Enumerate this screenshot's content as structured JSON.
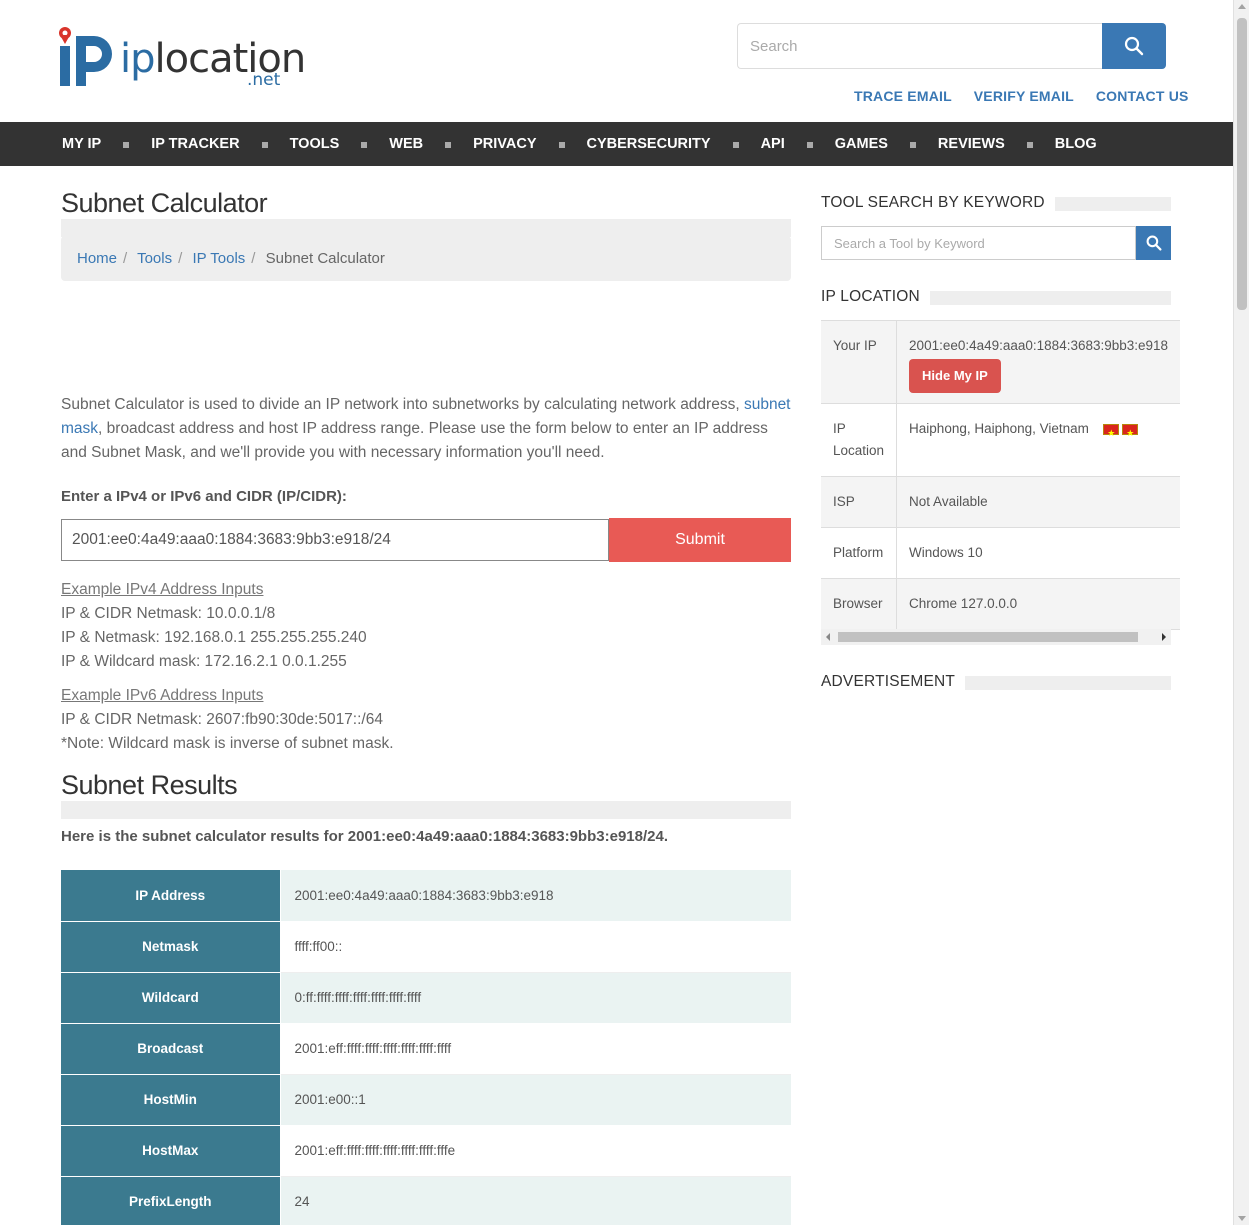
{
  "header": {
    "logo_ip": "ip",
    "logo_location": "location",
    "logo_net": ".net",
    "search_placeholder": "Search",
    "links": [
      "TRACE EMAIL",
      "VERIFY EMAIL",
      "CONTACT US"
    ]
  },
  "nav": [
    "MY IP",
    "IP TRACKER",
    "TOOLS",
    "WEB",
    "PRIVACY",
    "CYBERSECURITY",
    "API",
    "GAMES",
    "REVIEWS",
    "BLOG"
  ],
  "page": {
    "title": "Subnet Calculator",
    "breadcrumb": {
      "home": "Home",
      "tools": "Tools",
      "ip_tools": "IP Tools",
      "current": "Subnet Calculator"
    },
    "intro": {
      "before_link": "Subnet Calculator is used to divide an IP network into subnetworks by calculating network address, ",
      "link": "subnet mask",
      "after_link": ", broadcast address and host IP address range. Please use the form below to enter an IP address and Subnet Mask, and we'll provide you with necessary information you'll need."
    },
    "form": {
      "label": "Enter a IPv4 or IPv6 and CIDR (IP/CIDR):",
      "value": "2001:ee0:4a49:aaa0:1884:3683:9bb3:e918/24",
      "submit": "Submit"
    },
    "examples_v4": {
      "title": "Example IPv4 Address Inputs",
      "lines": [
        "IP & CIDR Netmask: 10.0.0.1/8",
        "IP & Netmask: 192.168.0.1 255.255.255.240",
        "IP & Wildcard mask: 172.16.2.1 0.0.1.255"
      ]
    },
    "examples_v6": {
      "title": "Example IPv6 Address Inputs",
      "lines": [
        "IP & CIDR Netmask: 2607:fb90:30de:5017::/64",
        "*Note: Wildcard mask is inverse of subnet mask."
      ]
    },
    "results_title": "Subnet Results",
    "results_intro": "Here is the subnet calculator results for 2001:ee0:4a49:aaa0:1884:3683:9bb3:e918/24.",
    "results": [
      {
        "key": "IP Address",
        "value": "2001:ee0:4a49:aaa0:1884:3683:9bb3:e918"
      },
      {
        "key": "Netmask",
        "value": "ffff:ff00::"
      },
      {
        "key": "Wildcard",
        "value": "0:ff:ffff:ffff:ffff:ffff:ffff:ffff"
      },
      {
        "key": "Broadcast",
        "value": "2001:eff:ffff:ffff:ffff:ffff:ffff:ffff"
      },
      {
        "key": "HostMin",
        "value": "2001:e00::1"
      },
      {
        "key": "HostMax",
        "value": "2001:eff:ffff:ffff:ffff:ffff:ffff:fffe"
      },
      {
        "key": "PrefixLength",
        "value": "24"
      }
    ]
  },
  "sidebar": {
    "tool_search_title": "TOOL SEARCH BY KEYWORD",
    "tool_search_placeholder": "Search a Tool by Keyword",
    "ip_location_title": "IP LOCATION",
    "your_ip_label": "Your IP",
    "your_ip_value": "2001:ee0:4a49:aaa0:1884:3683:9bb3:e918",
    "hide_button": "Hide My IP",
    "location_label_1": "IP",
    "location_label_2": "Location",
    "location_value": "Haiphong, Haiphong, Vietnam",
    "isp_label": "ISP",
    "isp_value": "Not Available",
    "platform_label": "Platform",
    "platform_value": "Windows 10",
    "browser_label": "Browser",
    "browser_value": "Chrome 127.0.0.0",
    "advertisement_title": "ADVERTISEMENT"
  },
  "colors": {
    "brand_blue": "#3a78b4",
    "nav_bg": "#333333",
    "submit_red": "#e85a55",
    "table_key_teal": "#3b7a8f",
    "hide_red": "#d9534f"
  }
}
